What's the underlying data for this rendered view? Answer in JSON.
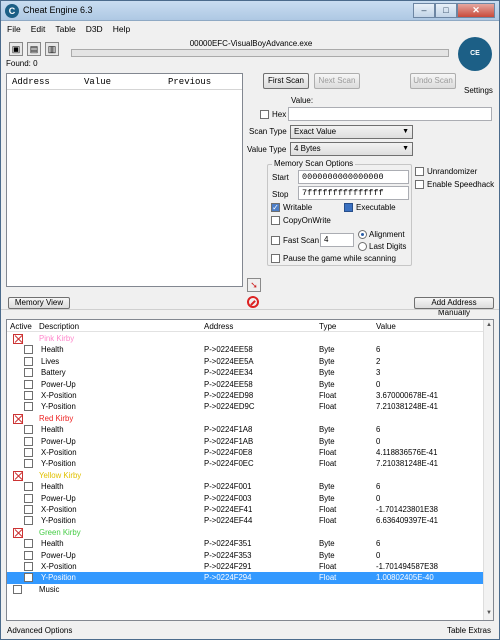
{
  "window": {
    "title": "Cheat Engine 6.3",
    "min": "–",
    "max": "□",
    "close": "✕"
  },
  "menu": [
    "File",
    "Edit",
    "Table",
    "D3D",
    "Help"
  ],
  "toolbar": {
    "process_name": "00000EFC-VisualBoyAdvance.exe",
    "found": "Found: 0",
    "settings": "Settings"
  },
  "results": {
    "col_address": "Address",
    "col_value": "Value",
    "col_previous": "Previous"
  },
  "scan": {
    "first_scan": "First Scan",
    "next_scan": "Next Scan",
    "undo_scan": "Undo Scan",
    "value_label": "Value:",
    "hex_label": "Hex",
    "scan_type_label": "Scan Type",
    "scan_type_value": "Exact Value",
    "value_type_label": "Value Type",
    "value_type_value": "4 Bytes",
    "memory_options_title": "Memory Scan Options",
    "start_label": "Start",
    "start_value": "0000000000000000",
    "stop_label": "Stop",
    "stop_value": "7fffffffffffffff",
    "writable": "Writable",
    "executable": "Executable",
    "copyonwrite": "CopyOnWrite",
    "fast_scan": "Fast Scan",
    "fast_scan_value": "4",
    "alignment": "Alignment",
    "last_digits": "Last Digits",
    "pause": "Pause the game while scanning",
    "unrandomizer": "Unrandomizer",
    "speedhack": "Enable Speedhack"
  },
  "buttons": {
    "memory_view": "Memory View",
    "add_address": "Add Address Manually"
  },
  "table": {
    "headers": {
      "active": "Active",
      "description": "Description",
      "address": "Address",
      "type": "Type",
      "value": "Value"
    },
    "rows": [
      {
        "group": true,
        "desc": "Pink Kirby",
        "color": "#ff88cc",
        "address": "",
        "type": "",
        "value": ""
      },
      {
        "desc": "Health",
        "address": "P->0224EE58",
        "type": "Byte",
        "value": "6"
      },
      {
        "desc": "Lives",
        "address": "P->0224EE5A",
        "type": "Byte",
        "value": "2"
      },
      {
        "desc": "Battery",
        "address": "P->0224EE34",
        "type": "Byte",
        "value": "3"
      },
      {
        "desc": "Power-Up",
        "address": "P->0224EE58",
        "type": "Byte",
        "value": "0"
      },
      {
        "desc": "X-Position",
        "address": "P->0224ED98",
        "type": "Float",
        "value": "3.670000678E-41"
      },
      {
        "desc": "Y-Position",
        "address": "P->0224ED9C",
        "type": "Float",
        "value": "7.210381248E-41"
      },
      {
        "group": true,
        "desc": "Red Kirby",
        "color": "#ee2222",
        "address": "",
        "type": "",
        "value": ""
      },
      {
        "desc": "Health",
        "address": "P->0224F1A8",
        "type": "Byte",
        "value": "6"
      },
      {
        "desc": "Power-Up",
        "address": "P->0224F1AB",
        "type": "Byte",
        "value": "0"
      },
      {
        "desc": "X-Position",
        "address": "P->0224F0E8",
        "type": "Float",
        "value": "4.118836576E-41"
      },
      {
        "desc": "Y-Position",
        "address": "P->0224F0EC",
        "type": "Float",
        "value": "7.210381248E-41"
      },
      {
        "group": true,
        "desc": "Yellow Kirby",
        "color": "#e0c000",
        "address": "",
        "type": "",
        "value": ""
      },
      {
        "desc": "Health",
        "address": "P->0224F001",
        "type": "Byte",
        "value": "6"
      },
      {
        "desc": "Power-Up",
        "address": "P->0224F003",
        "type": "Byte",
        "value": "0"
      },
      {
        "desc": "X-Position",
        "address": "P->0224EF41",
        "type": "Float",
        "value": "-1.701423801E38"
      },
      {
        "desc": "Y-Position",
        "address": "P->0224EF44",
        "type": "Float",
        "value": "6.636409397E-41"
      },
      {
        "group": true,
        "desc": "Green Kirby",
        "color": "#44cc44",
        "address": "",
        "type": "",
        "value": ""
      },
      {
        "desc": "Health",
        "address": "P->0224F351",
        "type": "Byte",
        "value": "6"
      },
      {
        "desc": "Power-Up",
        "address": "P->0224F353",
        "type": "Byte",
        "value": "0"
      },
      {
        "desc": "X-Position",
        "address": "P->0224F291",
        "type": "Float",
        "value": "-1.701494587E38"
      },
      {
        "desc": "Y-Position",
        "address": "P->0224F294",
        "type": "Float",
        "value": "1.00802405E-40",
        "selected": true
      },
      {
        "desc": "Music",
        "address": "",
        "type": "",
        "value": "",
        "top": true
      }
    ]
  },
  "status": {
    "left": "Advanced Options",
    "right": "Table Extras"
  }
}
